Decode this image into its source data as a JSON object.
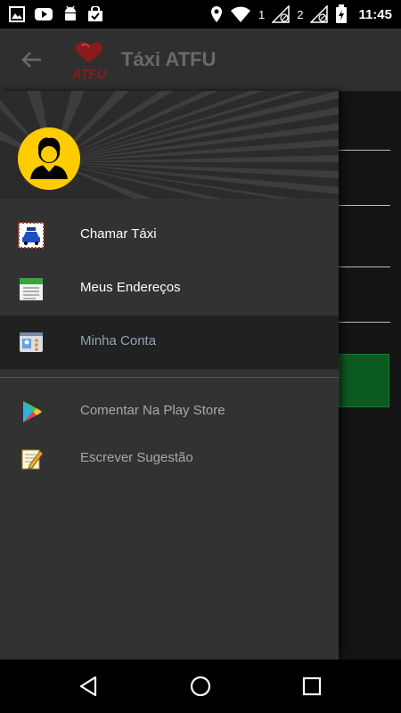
{
  "status_bar": {
    "icons": [
      "gallery-icon",
      "youtube-icon",
      "android-icon",
      "bag-check-icon"
    ],
    "right_icons": [
      "location-icon",
      "wifi-icon",
      "signal-sim1-icon",
      "signal-sim2-icon",
      "battery-charging-icon"
    ],
    "sim1": "1",
    "sim2": "2",
    "time": "11:45"
  },
  "app_bar": {
    "title": "Táxi ATFU",
    "logo_text": "ATFU",
    "back_icon": "arrow-back-icon"
  },
  "drawer": {
    "avatar_icon": "user-avatar-icon",
    "items": [
      {
        "label": "Chamar Táxi",
        "icon": "taxi-icon"
      },
      {
        "label": "Meus Endereços",
        "icon": "address-book-icon"
      },
      {
        "label": "Minha Conta",
        "icon": "account-card-icon",
        "selected": true
      },
      {
        "label": "Comentar Na Play Store",
        "icon": "play-store-icon"
      },
      {
        "label": "Escrever Sugestão",
        "icon": "edit-note-icon"
      }
    ]
  },
  "nav_bar": {
    "buttons": [
      "back-triangle-icon",
      "home-circle-icon",
      "recents-square-icon"
    ]
  },
  "colors": {
    "app_bar": "#2f2f2f",
    "drawer": "#323232",
    "avatar": "#ffcc00",
    "selected_row": "#212121",
    "content_green": "#0b5a1f"
  }
}
